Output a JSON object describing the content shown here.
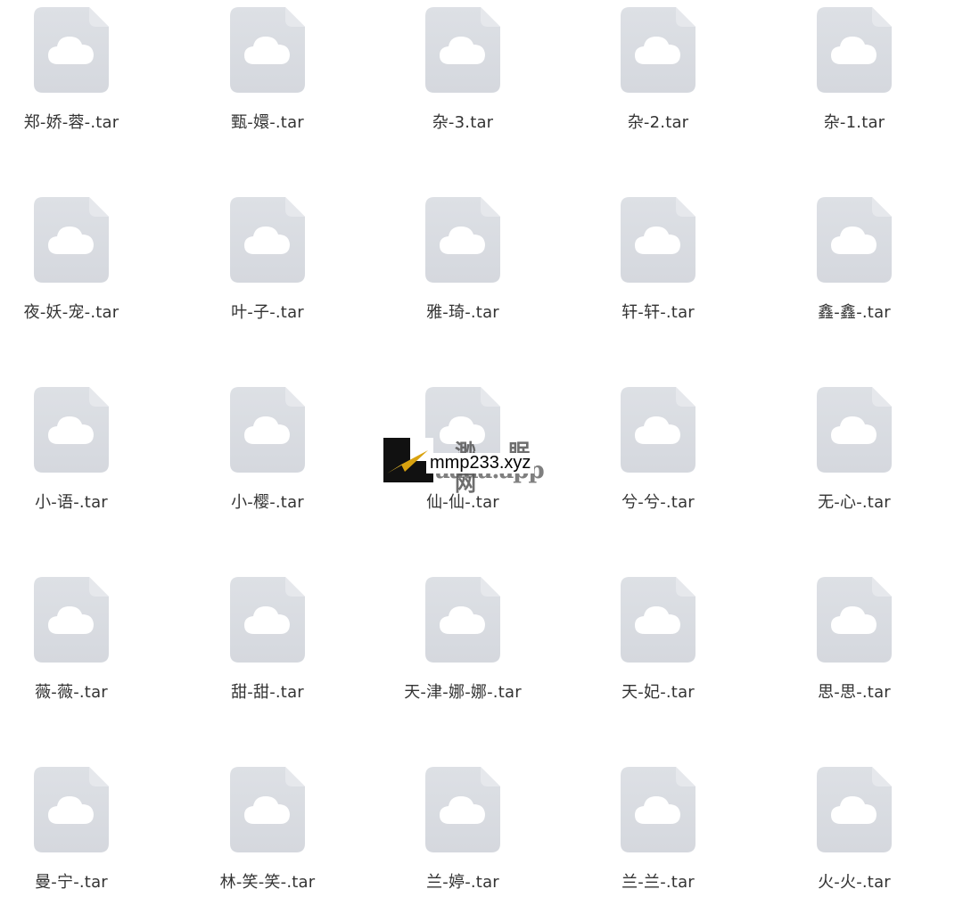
{
  "colors": {
    "icon_fill": "#d5d8de",
    "icon_fold": "#e6e8ec",
    "cloud": "#ffffff",
    "label": "#333333"
  },
  "files": [
    {
      "name": "郑-娇-蓉-.tar",
      "icon": "cloud-file-icon"
    },
    {
      "name": "甄-嬛-.tar",
      "icon": "cloud-file-icon"
    },
    {
      "name": "杂-3.tar",
      "icon": "cloud-file-icon"
    },
    {
      "name": "杂-2.tar",
      "icon": "cloud-file-icon"
    },
    {
      "name": "杂-1.tar",
      "icon": "cloud-file-icon"
    },
    {
      "name": "夜-妖-宠-.tar",
      "icon": "cloud-file-icon"
    },
    {
      "name": "叶-子-.tar",
      "icon": "cloud-file-icon"
    },
    {
      "name": "雅-琦-.tar",
      "icon": "cloud-file-icon"
    },
    {
      "name": "轩-轩-.tar",
      "icon": "cloud-file-icon"
    },
    {
      "name": "鑫-鑫-.tar",
      "icon": "cloud-file-icon"
    },
    {
      "name": "小-语-.tar",
      "icon": "cloud-file-icon"
    },
    {
      "name": "小-樱-.tar",
      "icon": "cloud-file-icon"
    },
    {
      "name": "仙-仙-.tar",
      "icon": "cloud-file-icon"
    },
    {
      "name": "兮-兮-.tar",
      "icon": "cloud-file-icon"
    },
    {
      "name": "无-心-.tar",
      "icon": "cloud-file-icon"
    },
    {
      "name": "薇-薇-.tar",
      "icon": "cloud-file-icon"
    },
    {
      "name": "甜-甜-.tar",
      "icon": "cloud-file-icon"
    },
    {
      "name": "天-津-娜-娜-.tar",
      "icon": "cloud-file-icon"
    },
    {
      "name": "天-妃-.tar",
      "icon": "cloud-file-icon"
    },
    {
      "name": "思-思-.tar",
      "icon": "cloud-file-icon"
    },
    {
      "name": "曼-宁-.tar",
      "icon": "cloud-file-icon"
    },
    {
      "name": "林-笑-笑-.tar",
      "icon": "cloud-file-icon"
    },
    {
      "name": "兰-婷-.tar",
      "icon": "cloud-file-icon"
    },
    {
      "name": "兰-兰-.tar",
      "icon": "cloud-file-icon"
    },
    {
      "name": "火-火-.tar",
      "icon": "cloud-file-icon"
    }
  ],
  "watermark": {
    "logo_icon": "paper-plane-logo-icon",
    "cn_text": "渺 眠 网",
    "en_text": "aaaa.app",
    "url_text": "mmp233.xyz"
  }
}
